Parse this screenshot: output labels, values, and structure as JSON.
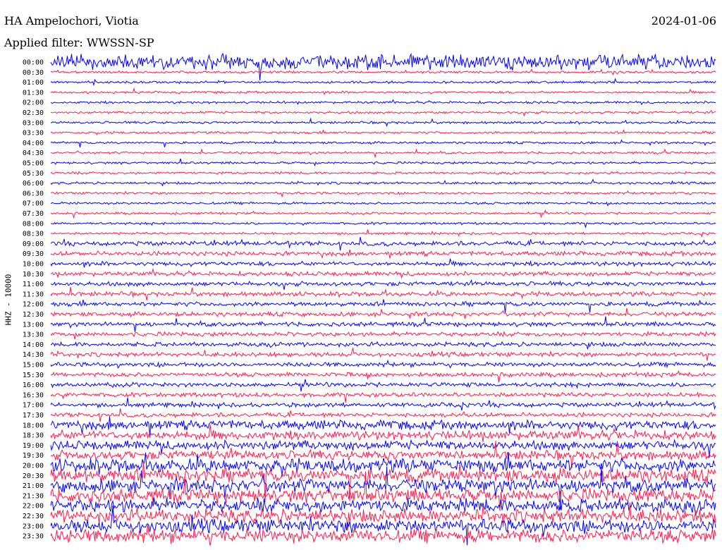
{
  "header": {
    "station": "HA Ampelochori, Viotia",
    "filter_label": "Applied filter:",
    "filter_value": "WWSSN-SP",
    "date": "2024-01-06"
  },
  "channel_label": "HHZ - 10000",
  "colors": {
    "line_a": "#0000ff",
    "line_b": "#ff1a4d",
    "background": "#ffffff",
    "text": "#000000"
  },
  "chart_data": {
    "type": "line",
    "title": "HA Ampelochori, Viotia",
    "subtitle": "Applied filter: WWSSN-SP",
    "ylabel": "HHZ - 10000",
    "row_interval_minutes": 30,
    "row_labels": [
      "00:00",
      "00:30",
      "01:00",
      "01:30",
      "02:00",
      "02:30",
      "03:00",
      "03:30",
      "04:00",
      "04:30",
      "05:00",
      "05:30",
      "06:00",
      "06:30",
      "07:00",
      "07:30",
      "08:00",
      "08:30",
      "09:00",
      "09:30",
      "10:00",
      "10:30",
      "11:00",
      "11:30",
      "12:00",
      "12:30",
      "13:00",
      "13:30",
      "14:00",
      "14:30",
      "15:00",
      "15:30",
      "16:00",
      "16:30",
      "17:00",
      "17:30",
      "18:00",
      "18:30",
      "19:00",
      "19:30",
      "20:00",
      "20:30",
      "21:00",
      "21:30",
      "22:00",
      "22:30",
      "23:00",
      "23:30"
    ],
    "alternating_colors": [
      "#0000ff",
      "#ff1a4d"
    ],
    "grid": false,
    "legend": "none"
  }
}
